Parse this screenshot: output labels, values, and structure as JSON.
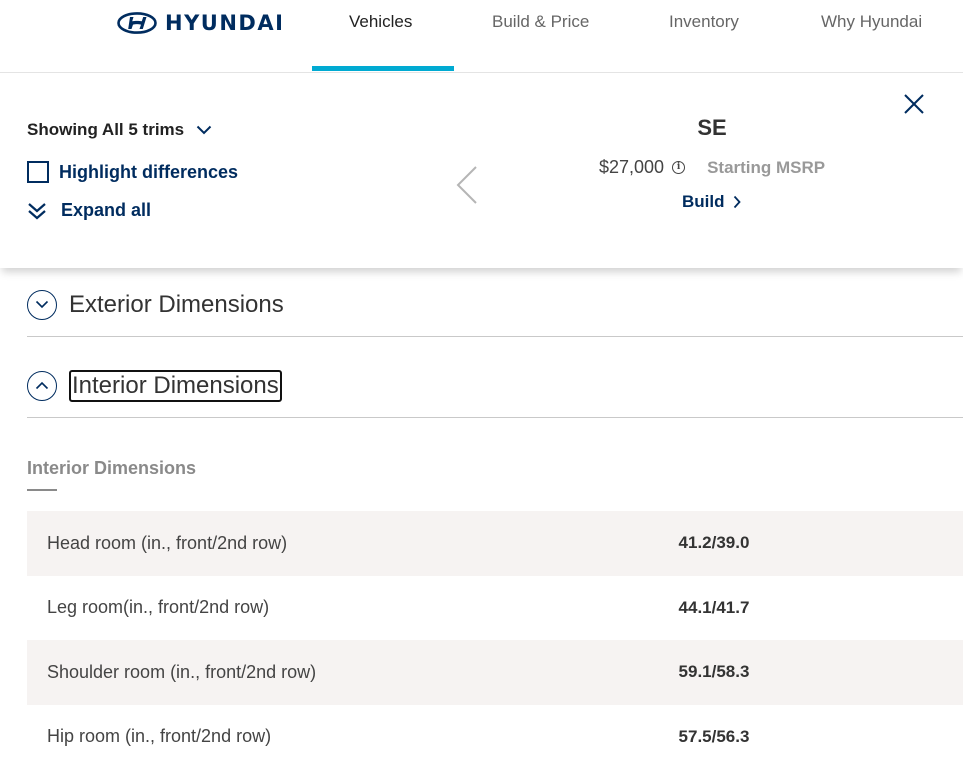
{
  "brand": {
    "logo_text": "HYUNDAI"
  },
  "nav": {
    "items": [
      {
        "label": "Vehicles",
        "active": true
      },
      {
        "label": "Build & Price",
        "active": false
      },
      {
        "label": "Inventory",
        "active": false
      },
      {
        "label": "Why Hyundai",
        "active": false
      }
    ],
    "accent_color": "#00aad2"
  },
  "compare": {
    "trims_label": "Showing All 5 trims",
    "highlight_label": "Highlight differences",
    "highlight_checked": false,
    "expand_label": "Expand all",
    "trim": {
      "name": "SE",
      "price": "$27,000",
      "msrp_label": "Starting MSRP",
      "build_label": "Build"
    }
  },
  "accordions": [
    {
      "title": "Exterior Dimensions",
      "expanded": false
    },
    {
      "title": "Interior Dimensions",
      "expanded": true
    }
  ],
  "interior": {
    "section_title": "Interior Dimensions",
    "rows": [
      {
        "label": "Head room (in., front/2nd row)",
        "value": "41.2/39.0"
      },
      {
        "label": "Leg room(in., front/2nd row)",
        "value": "44.1/41.7"
      },
      {
        "label": "Shoulder room (in., front/2nd row)",
        "value": "59.1/58.3"
      },
      {
        "label": "Hip room (in., front/2nd row)",
        "value": "57.5/56.3"
      }
    ]
  },
  "colors": {
    "brand_navy": "#002c5f",
    "row_shade": "#f6f3f2"
  }
}
